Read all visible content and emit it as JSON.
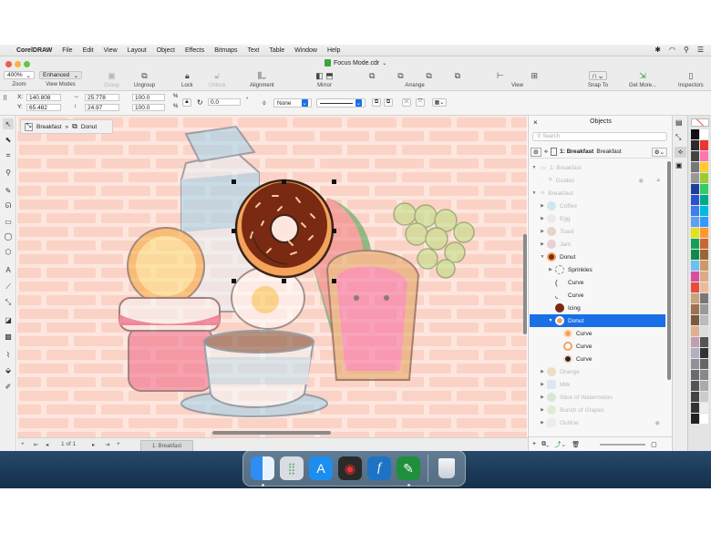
{
  "menubar": {
    "app_name": "CorelDRAW",
    "items": [
      "File",
      "Edit",
      "View",
      "Layout",
      "Object",
      "Effects",
      "Bitmaps",
      "Text",
      "Table",
      "Window",
      "Help"
    ]
  },
  "window": {
    "title": "Focus Mode.cdr"
  },
  "toolbar": {
    "zoom_value": "400%",
    "zoom_label": "Zoom",
    "view_mode_value": "Enhanced",
    "view_mode_label": "View Modes",
    "group_label": "Group",
    "ungroup_label": "Ungroup",
    "lock_label": "Lock",
    "unlock_label": "Unlock",
    "alignment_label": "Alignment",
    "mirror_label": "Mirror",
    "arrange_label": "Arrange",
    "view_label": "View",
    "snap_to_label": "Snap To",
    "get_more_label": "Get More...",
    "inspectors_label": "Inspectors"
  },
  "propbar": {
    "x_label": "X:",
    "x_value": "140.808",
    "y_label": "Y:",
    "y_value": "65.482",
    "width_value": "25.778",
    "height_value": "24.97",
    "scale_w": "100.0",
    "scale_h": "100.0",
    "percent": "%",
    "rotation_value": "0.0",
    "degree": "°",
    "fill_value": "None"
  },
  "breadcrumb": {
    "parent": "Breadcrumb_parent",
    "parent_label": "Breakfast",
    "separator": "»",
    "child_label": "Donut"
  },
  "pagebar": {
    "page_count": "1  of  1",
    "page_tab": "1: Breakfast"
  },
  "objects_panel": {
    "title": "Objects",
    "search_placeholder": "Search",
    "page_label": "1: Breakfast",
    "page_label_suffix": "Breakfast",
    "rows": [
      {
        "label": "1: Breakfast",
        "indent": 0,
        "dim": true
      },
      {
        "label": "Guides",
        "indent": 1,
        "dim": true
      },
      {
        "label": "Breakfast",
        "indent": 0,
        "dim": true
      },
      {
        "label": "Coffee",
        "indent": 1,
        "dim": true
      },
      {
        "label": "Egg",
        "indent": 1,
        "dim": true
      },
      {
        "label": "Toast",
        "indent": 1,
        "dim": true
      },
      {
        "label": "Jam",
        "indent": 1,
        "dim": true
      },
      {
        "label": "Donut",
        "indent": 1,
        "dim": false
      },
      {
        "label": "Sprinkles",
        "indent": 2,
        "dim": false
      },
      {
        "label": "Curve",
        "indent": 2,
        "dim": false
      },
      {
        "label": "Curve",
        "indent": 2,
        "dim": false
      },
      {
        "label": "Icing",
        "indent": 2,
        "dim": false
      },
      {
        "label": "Donut",
        "indent": 2,
        "dim": false,
        "selected": true
      },
      {
        "label": "Curve",
        "indent": 3,
        "dim": false
      },
      {
        "label": "Curve",
        "indent": 3,
        "dim": false
      },
      {
        "label": "Curve",
        "indent": 3,
        "dim": false
      },
      {
        "label": "Orange",
        "indent": 1,
        "dim": true
      },
      {
        "label": "Milk",
        "indent": 1,
        "dim": true
      },
      {
        "label": "Slice of Watermelon",
        "indent": 1,
        "dim": true
      },
      {
        "label": "Bunch of Grapes",
        "indent": 1,
        "dim": true
      },
      {
        "label": "Outline",
        "indent": 1,
        "dim": true
      }
    ]
  },
  "colors": {
    "selection": "#1a6fe6",
    "canvas_bg": "#fde6dd",
    "brick": "#fbd1c6",
    "donut_dough": "#e0893b",
    "donut_icing": "#7a2a12"
  }
}
